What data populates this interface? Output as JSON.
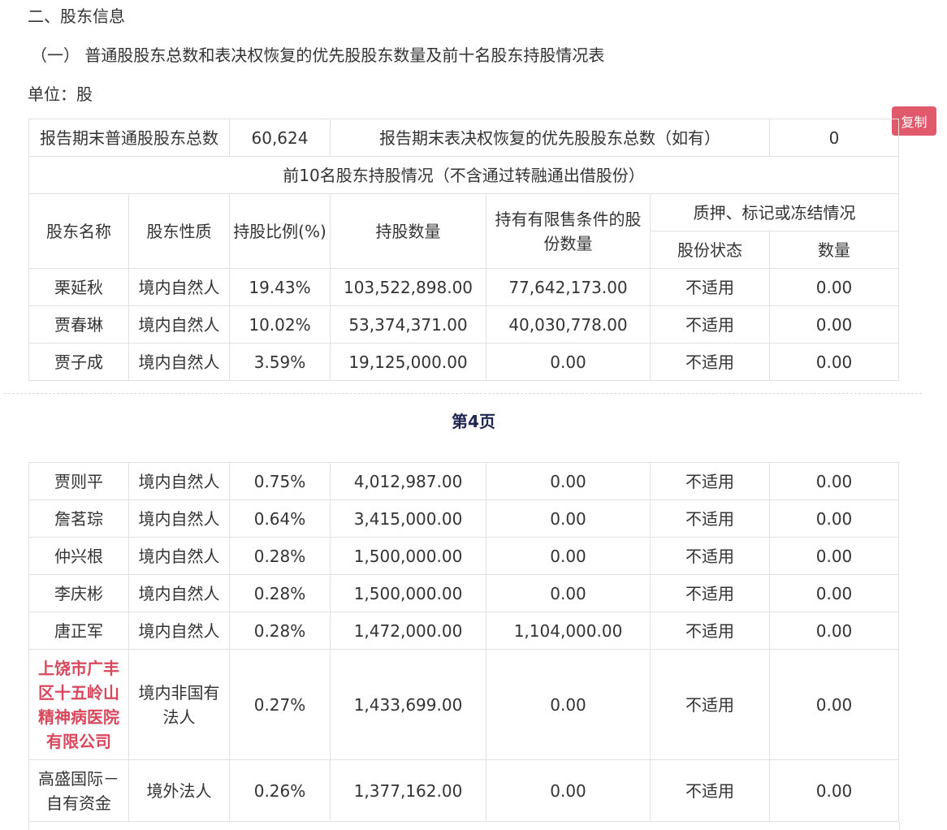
{
  "section_title": "二、股东信息",
  "sub_title": "（一） 普通股股东总数和表决权恢复的优先股股东数量及前十名股东持股情况表",
  "unit": "单位：股",
  "copy_button": "复制",
  "summary": {
    "common_label": "报告期末普通股股东总数",
    "common_value": "60,624",
    "preferred_label": "报告期末表决权恢复的优先股股东总数（如有）",
    "preferred_value": "0"
  },
  "top10_caption": "前10名股东持股情况（不含通过转融通出借股份）",
  "headers": {
    "name": "股东名称",
    "nature": "股东性质",
    "ratio": "持股比例(%)",
    "quantity": "持股数量",
    "restricted": "持有有限售条件的股份数量",
    "pledge": "质押、标记或冻结情况",
    "status": "股份状态",
    "count": "数量"
  },
  "rows_page1": [
    {
      "name": "栗延秋",
      "nature": "境内自然人",
      "ratio": "19.43%",
      "quantity": "103,522,898.00",
      "restricted": "77,642,173.00",
      "status": "不适用",
      "count": "0.00"
    },
    {
      "name": "贾春琳",
      "nature": "境内自然人",
      "ratio": "10.02%",
      "quantity": "53,374,371.00",
      "restricted": "40,030,778.00",
      "status": "不适用",
      "count": "0.00"
    },
    {
      "name": "贾子成",
      "nature": "境内自然人",
      "ratio": "3.59%",
      "quantity": "19,125,000.00",
      "restricted": "0.00",
      "status": "不适用",
      "count": "0.00"
    }
  ],
  "page_label": "第4页",
  "rows_page2": [
    {
      "name": "贾则平",
      "nature": "境内自然人",
      "ratio": "0.75%",
      "quantity": "4,012,987.00",
      "restricted": "0.00",
      "status": "不适用",
      "count": "0.00"
    },
    {
      "name": "詹茗琮",
      "nature": "境内自然人",
      "ratio": "0.64%",
      "quantity": "3,415,000.00",
      "restricted": "0.00",
      "status": "不适用",
      "count": "0.00"
    },
    {
      "name": "仲兴根",
      "nature": "境内自然人",
      "ratio": "0.28%",
      "quantity": "1,500,000.00",
      "restricted": "0.00",
      "status": "不适用",
      "count": "0.00"
    },
    {
      "name": "李庆彬",
      "nature": "境内自然人",
      "ratio": "0.28%",
      "quantity": "1,500,000.00",
      "restricted": "0.00",
      "status": "不适用",
      "count": "0.00"
    },
    {
      "name": "唐正军",
      "nature": "境内自然人",
      "ratio": "0.28%",
      "quantity": "1,472,000.00",
      "restricted": "1,104,000.00",
      "status": "不适用",
      "count": "0.00"
    },
    {
      "name": "上饶市广丰区十五岭山精神病医院有限公司",
      "nature": "境内非国有法人",
      "ratio": "0.27%",
      "quantity": "1,433,699.00",
      "restricted": "0.00",
      "status": "不适用",
      "count": "0.00"
    },
    {
      "name": "高盛国际－自有资金",
      "nature": "境外法人",
      "ratio": "0.26%",
      "quantity": "1,377,162.00",
      "restricted": "0.00",
      "status": "不适用",
      "count": "0.00"
    }
  ],
  "highlight_color": "#d9475c",
  "copy_button_color": "#e05a6b"
}
